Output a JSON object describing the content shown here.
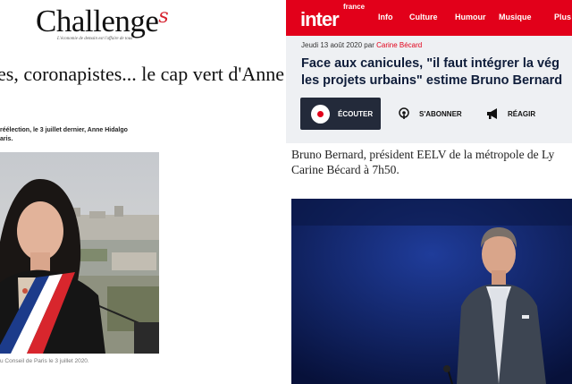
{
  "challenges": {
    "logo_text": "Challenge",
    "logo_s": "s",
    "tagline": "L'économie de demain est l'affaire de tous",
    "headline": "es, coronapistes... le cap vert d'Anne",
    "intro": [
      "réélection, le 3 juillet dernier, Anne Hidalgo",
      "aris."
    ],
    "caption": "u Conseil de Paris le 3 juillet 2020."
  },
  "inter": {
    "logo_small": "france",
    "logo_big": "inter",
    "nav": [
      "Info",
      "Culture",
      "Humour",
      "Musique",
      "Plus"
    ],
    "date": "Jeudi 13 août 2020",
    "by": "par",
    "author": "Carine Bécard",
    "title_lines": [
      "Face aux canicules, \"il faut intégrer la vég",
      "les projets urbains\" estime Bruno Bernard"
    ],
    "buttons": {
      "listen": "ÉCOUTER",
      "subscribe": "S'ABONNER",
      "react": "RÉAGIR"
    },
    "lead_lines": [
      "Bruno Bernard, président EELV de la métropole de Ly",
      "Carine Bécard à 7h50."
    ]
  },
  "colors": {
    "inter_red": "#e2001a",
    "inter_navy": "#0f1d3a",
    "challenges_red": "#d6232f"
  }
}
